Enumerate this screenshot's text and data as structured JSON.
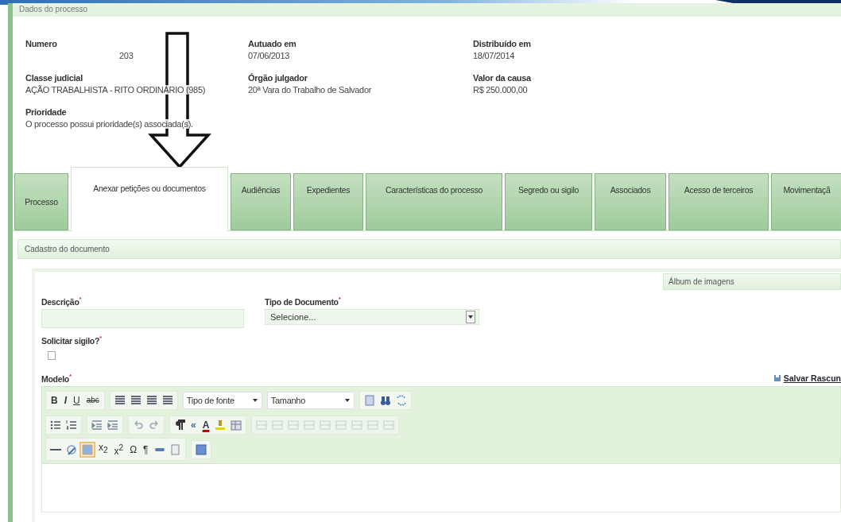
{
  "section_title": "Dados do processo",
  "fields": [
    {
      "label": "Numero",
      "value": "203"
    },
    {
      "label": "Autuado em",
      "value": "07/06/2013"
    },
    {
      "label": "Distribuído em",
      "value": "18/07/2014"
    },
    {
      "label": "Classe judicial",
      "value": "AÇÃO TRABALHISTA - RITO ORDINÁRIO (985)"
    },
    {
      "label": "Órgão julgador",
      "value": "20ª Vara do Trabalho de Salvador"
    },
    {
      "label": "Valor da causa",
      "value": "R$ 250.000,00"
    },
    {
      "label": "Prioridade",
      "value": "O processo possui prioridade(s) associada(s)."
    }
  ],
  "tabs": [
    {
      "label": "Processo",
      "selected": false
    },
    {
      "label": "Anexar petições ou documentos",
      "selected": true
    },
    {
      "label": "Audiências",
      "selected": false
    },
    {
      "label": "Expedientes",
      "selected": false
    },
    {
      "label": "Características do processo",
      "selected": false
    },
    {
      "label": "Segredo ou sigilo",
      "selected": false
    },
    {
      "label": "Associados",
      "selected": false
    },
    {
      "label": "Acesso de terceiros",
      "selected": false
    },
    {
      "label": "Movimentaçã",
      "selected": false
    }
  ],
  "form": {
    "title": "Cadastro do documento",
    "album": "Álbum de imagens",
    "description_label": "Descrição",
    "type_label": "Tipo de Documento",
    "type_value": "Selecione...",
    "secret_label": "Solicitar sigilo?",
    "secret_checked": false,
    "model_label": "Modelo",
    "save_draft": "Salvar Rascun",
    "required_mark": "*"
  },
  "editor": {
    "font_select": "Tipo de fonte",
    "size_select": "Tamanho",
    "glyphs": [
      "B",
      "I",
      "U",
      "abc",
      "«",
      "A",
      "x$_{2}$",
      "x$^{2}$",
      "Ω",
      "¶"
    ]
  }
}
